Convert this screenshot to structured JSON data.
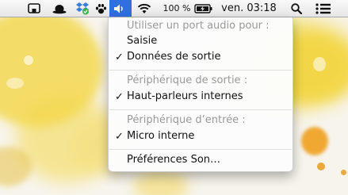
{
  "menubar": {
    "battery_percent": "100 %",
    "clock": "ven. 03:18",
    "icons": [
      "screen-mirroring-icon",
      "bowler-hat-icon",
      "dropbox-icon",
      "paw-icon",
      "volume-icon",
      "wifi-icon",
      "battery-charging-icon",
      "spotlight-search-icon",
      "notification-list-icon"
    ]
  },
  "sound_menu": {
    "sections": [
      {
        "header": "Utiliser un port audio pour :",
        "items": [
          {
            "label": "Saisie",
            "checked": false
          },
          {
            "label": "Données de sortie",
            "checked": true
          }
        ]
      },
      {
        "header": "Périphérique de sortie :",
        "items": [
          {
            "label": "Haut-parleurs internes",
            "checked": true
          }
        ]
      },
      {
        "header": "Périphérique d’entrée :",
        "items": [
          {
            "label": "Micro interne",
            "checked": true
          }
        ]
      }
    ],
    "preferences": "Préférences Son…",
    "check_glyph": "✓"
  },
  "colors": {
    "menubar_highlight": "#2f6fe0",
    "header_text": "#9a9a9a",
    "watercolor_yellow": "#f2d23a",
    "watercolor_orange": "#f0a020"
  }
}
